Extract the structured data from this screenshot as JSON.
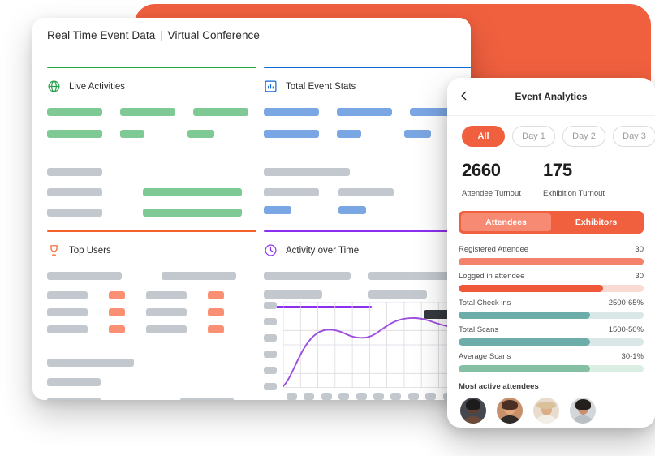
{
  "desktop": {
    "title_main": "Real Time Event Data",
    "title_sep": "|",
    "title_sub": "Virtual Conference",
    "panels": [
      {
        "key": "live",
        "label": "Live Activities",
        "icon": "globe-icon",
        "accent": "#23a24b"
      },
      {
        "key": "stats",
        "label": "Total Event Stats",
        "icon": "bar-chart-icon",
        "accent": "#1168d4"
      },
      {
        "key": "top",
        "label": "Top Users",
        "icon": "trophy-icon",
        "accent": "#f4622e"
      },
      {
        "key": "activity",
        "label": "Activity over Time",
        "icon": "clock-icon",
        "accent": "#8b2ff0"
      }
    ]
  },
  "chart_data": {
    "type": "line",
    "title": "Activity over Time",
    "xlabel": "",
    "ylabel": "",
    "grid": true,
    "legend": false,
    "line_color": "#9b4fe0",
    "x": [
      0,
      1,
      2,
      3,
      4,
      5,
      6,
      7,
      8,
      9,
      10,
      11,
      12
    ],
    "values": [
      2,
      22,
      54,
      64,
      61,
      56,
      57,
      64,
      74,
      79,
      79,
      73,
      71
    ],
    "ylim": [
      0,
      100
    ],
    "xlim": [
      0,
      12
    ],
    "tooltip_visible": true,
    "y_tick_count": 6,
    "x_tick_count": 11
  },
  "mobile": {
    "title": "Event Analytics",
    "back_icon": "chevron-left-icon",
    "day_chips": [
      {
        "label": "All",
        "active": true
      },
      {
        "label": "Day 1",
        "active": false
      },
      {
        "label": "Day 2",
        "active": false
      },
      {
        "label": "Day 3",
        "active": false
      }
    ],
    "kpis": [
      {
        "value": "2660",
        "caption": "Attendee Turnout"
      },
      {
        "value": "175",
        "caption": "Exhibition Turnout"
      }
    ],
    "segments": [
      {
        "label": "Attendees",
        "active": true
      },
      {
        "label": "Exhibitors",
        "active": false
      }
    ],
    "stats": [
      {
        "name": "Registered Attendee",
        "value": "30",
        "percent": 100,
        "fill": "#f4836b",
        "track": "#f4836b"
      },
      {
        "name": "Logged in attendee",
        "value": "30",
        "percent": 78,
        "fill": "#ef5838",
        "track": "#fadbd4"
      },
      {
        "name": "Total Check ins",
        "value": "2500-65%",
        "percent": 71,
        "fill": "#6cada9",
        "track": "#d9e8e6"
      },
      {
        "name": "Total Scans",
        "value": "1500-50%",
        "percent": 71,
        "fill": "#6cada9",
        "track": "#d9e8e6"
      },
      {
        "name": "Average Scans",
        "value": "30-1%",
        "percent": 71,
        "fill": "#85c0a4",
        "track": "#daeee4"
      }
    ],
    "active_title": "Most active attendees",
    "avatars": [
      {
        "name": "attendee-avatar-1",
        "bg": "#3c3f46",
        "skin": "#6b4a3a"
      },
      {
        "name": "attendee-avatar-2",
        "bg": "#c08a63",
        "skin": "#e0a878"
      },
      {
        "name": "attendee-avatar-3",
        "bg": "#e6d7c7",
        "skin": "#d9ae86"
      },
      {
        "name": "attendee-avatar-4",
        "bg": "#cfd3d6",
        "skin": "#c89374"
      }
    ]
  },
  "colors": {
    "brand_orange": "#f0603f",
    "green": "#23a24b",
    "blue": "#1168d4",
    "purple": "#8b2ff0",
    "skeleton_grey": "#c3c8ce",
    "skeleton_green": "#7ec994",
    "skeleton_blue": "#7aa6e3",
    "skeleton_orange": "#f99073"
  }
}
